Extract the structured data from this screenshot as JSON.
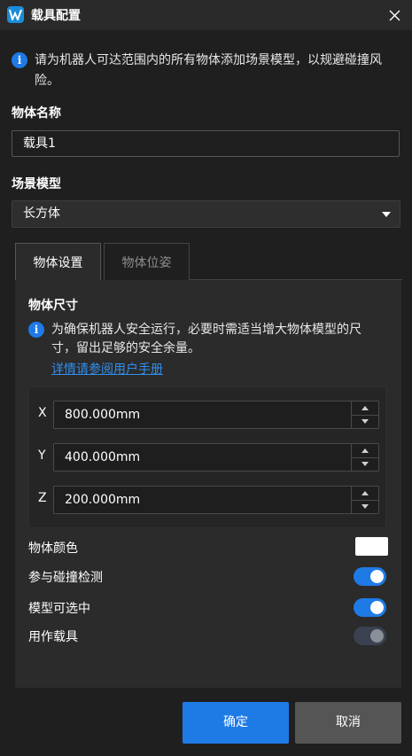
{
  "window": {
    "title": "载具配置",
    "app_icon": "app-logo-icon",
    "close_icon": "close-icon"
  },
  "notice": {
    "icon": "info-icon",
    "text": "请为机器人可达范围内的所有物体添加场景模型，以规避碰撞风险。"
  },
  "object_name": {
    "label": "物体名称",
    "value": "载具1"
  },
  "scene_model": {
    "label": "场景模型",
    "selected": "长方体"
  },
  "tabs": [
    {
      "label": "物体设置",
      "active": true
    },
    {
      "label": "物体位姿",
      "active": false
    }
  ],
  "settings": {
    "size_title": "物体尺寸",
    "size_notice": "为确保机器人安全运行，必要时需适当增大物体模型的尺寸，留出足够的安全余量。",
    "manual_link": "详情请参阅用户手册",
    "dims": [
      {
        "axis": "X",
        "value": "800.000mm"
      },
      {
        "axis": "Y",
        "value": "400.000mm"
      },
      {
        "axis": "Z",
        "value": "200.000mm"
      }
    ],
    "color_label": "物体颜色",
    "color_value": "#ffffff",
    "collision_label": "参与碰撞检测",
    "collision_on": true,
    "selectable_label": "模型可选中",
    "selectable_on": true,
    "carrier_label": "用作载具",
    "carrier_on": false
  },
  "buttons": {
    "ok": "确定",
    "cancel": "取消"
  },
  "colors": {
    "accent": "#1e7be6",
    "background": "#1f1f1f",
    "panel": "#2b2b2b",
    "link": "#2f8ff0"
  }
}
